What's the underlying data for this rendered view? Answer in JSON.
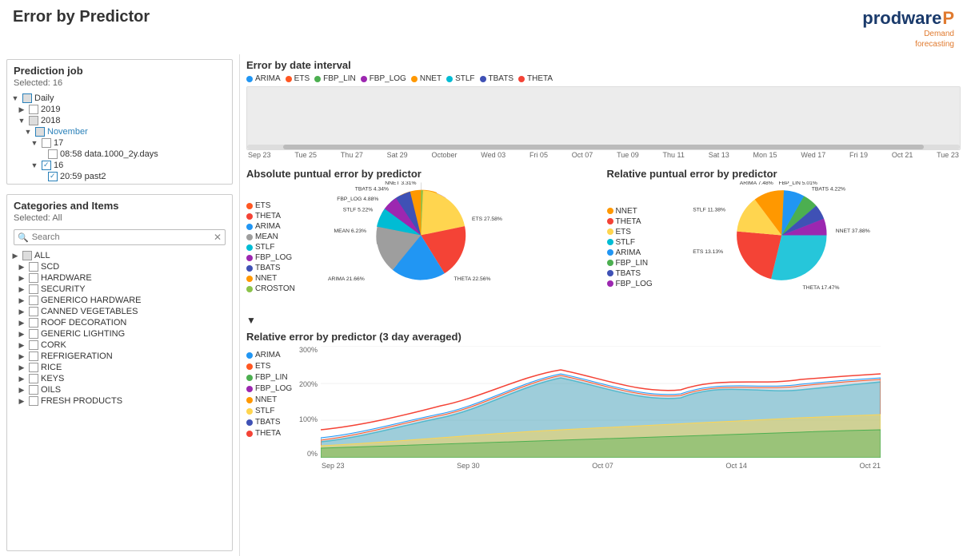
{
  "header": {
    "title_pre": "Error by ",
    "title_bold": "Predictor",
    "logo_name": "prodware",
    "logo_sub1": "Demand",
    "logo_sub2": "forecasting"
  },
  "prediction_job": {
    "title": "Prediction job",
    "selected": "Selected: 16",
    "tree": [
      {
        "level": 0,
        "label": "Daily",
        "expander": "▼",
        "checked": "partial",
        "indent": 0
      },
      {
        "level": 1,
        "label": "2019",
        "expander": "▶",
        "checked": "unchecked",
        "indent": 1
      },
      {
        "level": 1,
        "label": "2018",
        "expander": "▼",
        "checked": "partial",
        "indent": 1
      },
      {
        "level": 2,
        "label": "November",
        "expander": "▼",
        "checked": "partial",
        "indent": 2
      },
      {
        "level": 3,
        "label": "17",
        "expander": "▼",
        "checked": "unchecked",
        "indent": 3
      },
      {
        "level": 4,
        "label": "08:58 data.1000_2y.days",
        "expander": "",
        "checked": "unchecked",
        "indent": 4
      },
      {
        "level": 3,
        "label": "16",
        "expander": "▼",
        "checked": "checked",
        "indent": 3
      },
      {
        "level": 4,
        "label": "20:59 past2",
        "expander": "",
        "checked": "checked",
        "indent": 4
      }
    ]
  },
  "categories": {
    "title": "Categories and Items",
    "selected": "Selected: All",
    "search_placeholder": "Search",
    "items": [
      {
        "label": "ALL",
        "checked": "partial",
        "indent": 0,
        "expander": "▶"
      },
      {
        "label": "SCD",
        "checked": "unchecked",
        "indent": 1,
        "expander": "▶"
      },
      {
        "label": "HARDWARE",
        "checked": "unchecked",
        "indent": 1,
        "expander": "▶"
      },
      {
        "label": "SECURITY",
        "checked": "unchecked",
        "indent": 1,
        "expander": "▶"
      },
      {
        "label": "GENERICO HARDWARE",
        "checked": "unchecked",
        "indent": 1,
        "expander": "▶"
      },
      {
        "label": "CANNED VEGETABLES",
        "checked": "unchecked",
        "indent": 1,
        "expander": "▶"
      },
      {
        "label": "ROOF DECORATION",
        "checked": "unchecked",
        "indent": 1,
        "expander": "▶"
      },
      {
        "label": "GENERIC LIGHTING",
        "checked": "unchecked",
        "indent": 1,
        "expander": "▶"
      },
      {
        "label": "CORK",
        "checked": "unchecked",
        "indent": 1,
        "expander": "▶"
      },
      {
        "label": "REFRIGERATION",
        "checked": "unchecked",
        "indent": 1,
        "expander": "▶"
      },
      {
        "label": "RICE",
        "checked": "unchecked",
        "indent": 1,
        "expander": "▶"
      },
      {
        "label": "KEYS",
        "checked": "unchecked",
        "indent": 1,
        "expander": "▶"
      },
      {
        "label": "OILS",
        "checked": "unchecked",
        "indent": 1,
        "expander": "▶"
      },
      {
        "label": "FRESH PRODUCTS",
        "checked": "unchecked",
        "indent": 1,
        "expander": "▶"
      }
    ]
  },
  "error_by_date": {
    "title": "Error by date interval",
    "legend": [
      {
        "label": "ARIMA",
        "color": "#2196F3"
      },
      {
        "label": "ETS",
        "color": "#FF5722"
      },
      {
        "label": "FBP_LIN",
        "color": "#4CAF50"
      },
      {
        "label": "FBP_LOG",
        "color": "#9C27B0"
      },
      {
        "label": "NNET",
        "color": "#FF9800"
      },
      {
        "label": "STLF",
        "color": "#00BCD4"
      },
      {
        "label": "TBATS",
        "color": "#3F51B5"
      },
      {
        "label": "THETA",
        "color": "#F44336"
      }
    ],
    "x_labels": [
      "Sep 23",
      "Tue 25",
      "Thu 27",
      "Sat 29",
      "October",
      "Wed 03",
      "Fri 05",
      "Oct 07",
      "Tue 09",
      "Thu 11",
      "Sat 13",
      "Mon 15",
      "Wed 17",
      "Fri 19",
      "Oct 21",
      "Tue 23"
    ]
  },
  "abs_puntual": {
    "title": "Absolute puntual error by predictor",
    "legend": [
      {
        "label": "ETS",
        "color": "#FF5722"
      },
      {
        "label": "THETA",
        "color": "#F44336"
      },
      {
        "label": "ARIMA",
        "color": "#2196F3"
      },
      {
        "label": "MEAN",
        "color": "#9E9E9E"
      },
      {
        "label": "STLF",
        "color": "#00BCD4"
      },
      {
        "label": "FBP_LOG",
        "color": "#9C27B0"
      },
      {
        "label": "TBATS",
        "color": "#3F51B5"
      },
      {
        "label": "NNET",
        "color": "#FF9800"
      },
      {
        "label": "CROSTON",
        "color": "#8BC34A"
      }
    ],
    "slices": [
      {
        "label": "ETS 27.58%",
        "pct": 27.58,
        "color": "#FFD54F"
      },
      {
        "label": "THETA 22.56%",
        "pct": 22.56,
        "color": "#F44336"
      },
      {
        "label": "ARIMA 21.66%",
        "pct": 21.66,
        "color": "#2196F3"
      },
      {
        "label": "MEAN 6.23%",
        "pct": 6.23,
        "color": "#9E9E9E"
      },
      {
        "label": "STLF 5.22%",
        "pct": 5.22,
        "color": "#00BCD4"
      },
      {
        "label": "FBP_LOG 4.88%",
        "pct": 4.88,
        "color": "#9C27B0"
      },
      {
        "label": "TBATS 4.34%",
        "pct": 4.34,
        "color": "#3F51B5"
      },
      {
        "label": "NNET 3.31%",
        "pct": 3.31,
        "color": "#FF9800"
      },
      {
        "label": "CROSTON",
        "pct": 4.22,
        "color": "#8BC34A"
      }
    ]
  },
  "rel_puntual": {
    "title": "Relative puntual error by predictor",
    "legend": [
      {
        "label": "NNET",
        "color": "#FF9800"
      },
      {
        "label": "THETA",
        "color": "#F44336"
      },
      {
        "label": "ETS",
        "color": "#FFD54F"
      },
      {
        "label": "STLF",
        "color": "#00BCD4"
      },
      {
        "label": "ARIMA",
        "color": "#2196F3"
      },
      {
        "label": "FBP_LIN",
        "color": "#4CAF50"
      },
      {
        "label": "TBATS",
        "color": "#3F51B5"
      },
      {
        "label": "FBP_LOG",
        "color": "#9C27B0"
      }
    ],
    "slices": [
      {
        "label": "NNET 37.88%",
        "pct": 37.88,
        "color": "#26C6DA"
      },
      {
        "label": "THETA 17.47%",
        "pct": 17.47,
        "color": "#F44336"
      },
      {
        "label": "ETS 13.13%",
        "pct": 13.13,
        "color": "#FFD54F"
      },
      {
        "label": "STLF 11.38%",
        "pct": 11.38,
        "color": "#FF9800"
      },
      {
        "label": "ARIMA 7.48%",
        "pct": 7.48,
        "color": "#2196F3"
      },
      {
        "label": "FBP_LIN 5.01%",
        "pct": 5.01,
        "color": "#4CAF50"
      },
      {
        "label": "TBATS 4.22%",
        "pct": 4.22,
        "color": "#3F51B5"
      },
      {
        "label": "FBP_LOG",
        "pct": 3.43,
        "color": "#9C27B0"
      }
    ]
  },
  "rel_error_avg": {
    "title": "Relative error by predictor (3 day averaged)",
    "y_labels": [
      "300%",
      "200%",
      "100%",
      "0%"
    ],
    "x_labels": [
      "Sep 23",
      "Sep 30",
      "Oct 07",
      "Oct 14",
      "Oct 21"
    ],
    "legend": [
      {
        "label": "ARIMA",
        "color": "#2196F3"
      },
      {
        "label": "ETS",
        "color": "#FF5722"
      },
      {
        "label": "FBP_LIN",
        "color": "#4CAF50"
      },
      {
        "label": "FBP_LOG",
        "color": "#9C27B0"
      },
      {
        "label": "NNET",
        "color": "#FF9800"
      },
      {
        "label": "STLF",
        "color": "#FFD54F"
      },
      {
        "label": "TBATS",
        "color": "#3F51B5"
      },
      {
        "label": "THETA",
        "color": "#F44336"
      }
    ]
  }
}
